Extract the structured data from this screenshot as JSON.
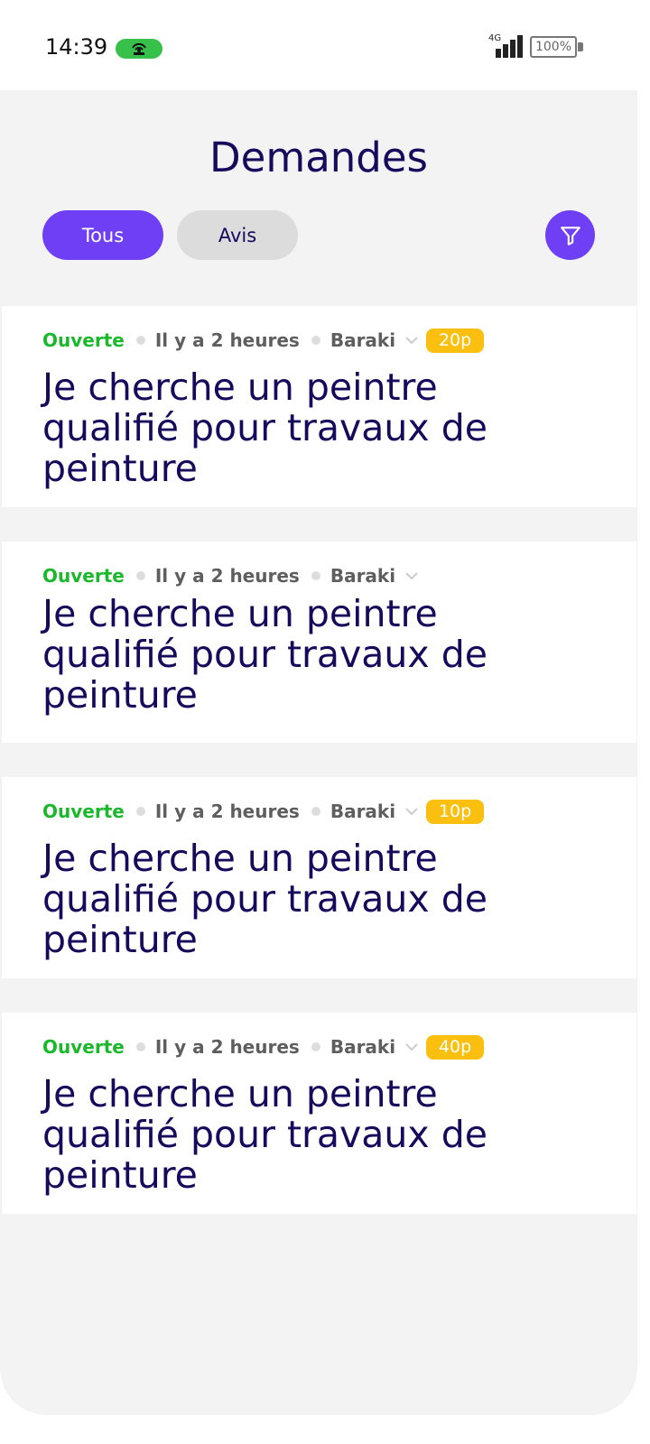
{
  "status_bar": {
    "time": "14:39",
    "network": "4G",
    "battery": "100%",
    "hotspot_color": "#37c04a"
  },
  "header": {
    "title": "Demandes"
  },
  "tabs": [
    {
      "label": "Tous",
      "active": true
    },
    {
      "label": "Avis",
      "active": false
    }
  ],
  "filter_button": {
    "icon": "filter-icon"
  },
  "colors": {
    "accent": "#6e3ff5",
    "title_text": "#160a5c",
    "status_open": "#1bb82c",
    "price_badge": "#fbbf0f"
  },
  "requests": [
    {
      "status": "Ouverte",
      "time": "Il y a 2 heures",
      "city": "Baraki",
      "price": "20p",
      "title": "Je cherche un peintre qualifié pour travaux de peinture"
    },
    {
      "status": "Ouverte",
      "time": "Il y a 2 heures",
      "city": "Baraki",
      "price": "",
      "title": "Je cherche un peintre qualifié pour travaux de peinture"
    },
    {
      "status": "Ouverte",
      "time": "Il y a 2 heures",
      "city": "Baraki",
      "price": "10p",
      "title": "Je cherche un peintre qualifié pour travaux de peinture"
    },
    {
      "status": "Ouverte",
      "time": "Il y a 2 heures",
      "city": "Baraki",
      "price": "40p",
      "title": "Je cherche un peintre qualifié pour travaux de peinture"
    }
  ]
}
